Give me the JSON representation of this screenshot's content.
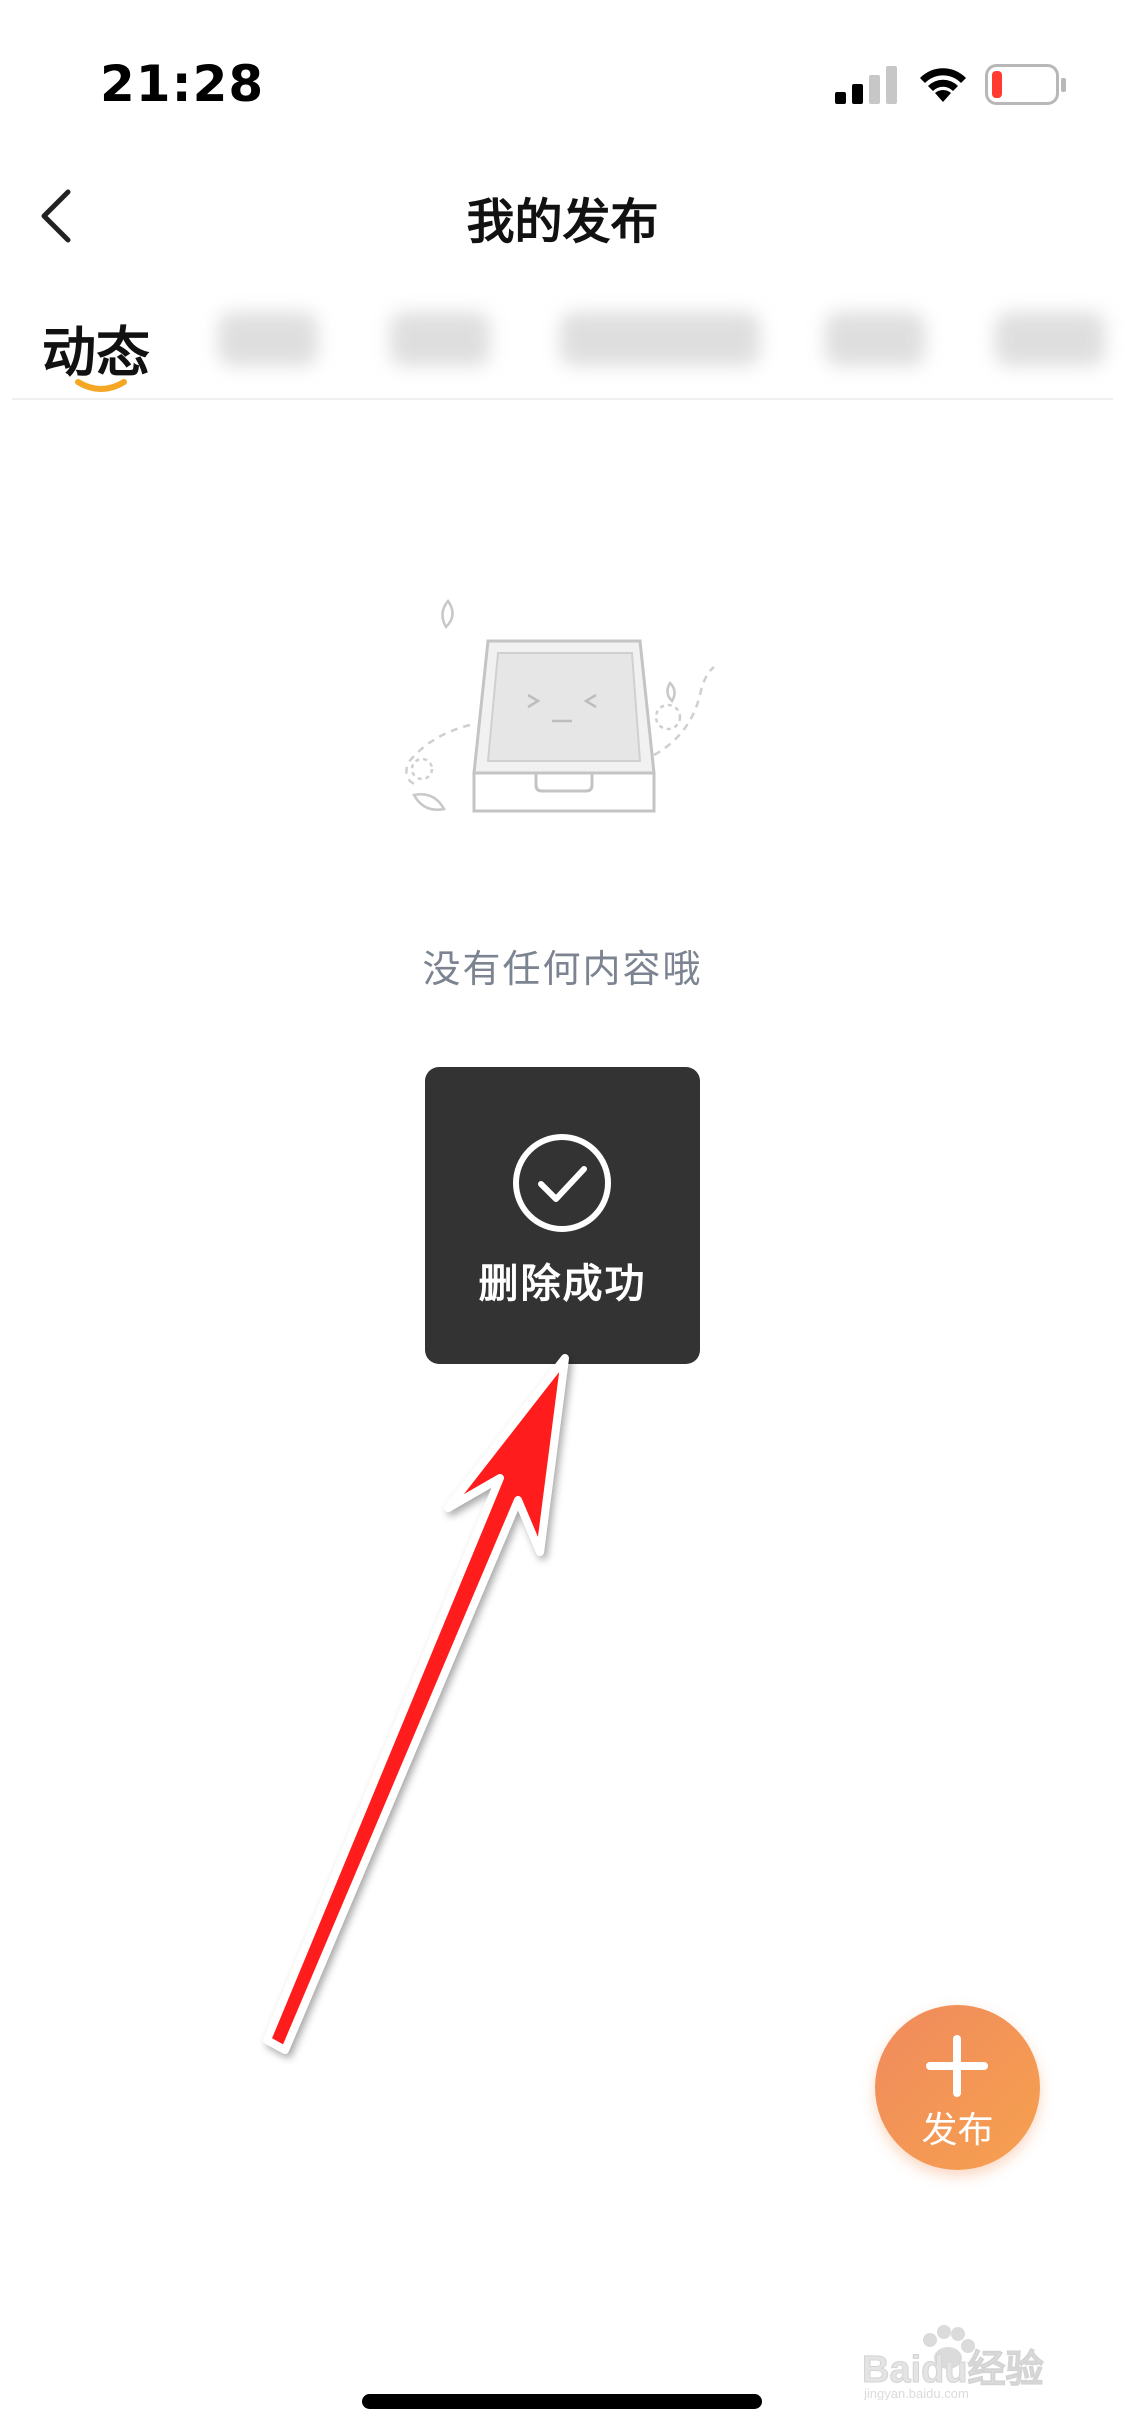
{
  "status_bar": {
    "time": "21:28"
  },
  "nav": {
    "title": "我的发布"
  },
  "tabs": {
    "active_label": "动态",
    "blurred_count": 6
  },
  "empty_state": {
    "message": "没有任何内容哦"
  },
  "toast": {
    "message": "删除成功"
  },
  "fab": {
    "label": "发布"
  },
  "watermark": {
    "text": "Baidu经验",
    "subtext": "jingyan.baidu.com"
  },
  "colors": {
    "accent": "#f5a623",
    "fab_gradient_start": "#f08a5d",
    "fab_gradient_end": "#f6a14f",
    "toast_bg": "#333333",
    "annotation_arrow": "#ff1a1a",
    "empty_text": "#7c8391"
  },
  "icons": {
    "back": "chevron-left-icon",
    "toast": "check-circle-icon",
    "fab": "plus-icon"
  }
}
